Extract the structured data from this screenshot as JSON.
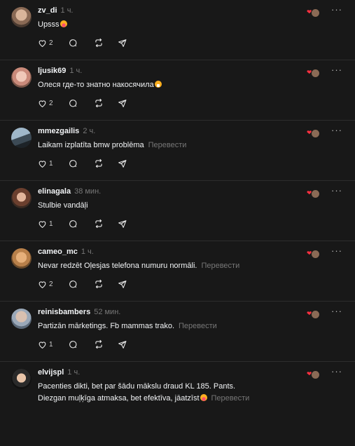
{
  "colors": {
    "background": "#181818",
    "divider": "#2d2d2d",
    "heart": "#ff3040",
    "muted": "#777777"
  },
  "icons": {
    "like": "heart-outline-icon",
    "reply": "comment-icon",
    "repost": "repost-icon",
    "share": "send-icon",
    "more": "more-icon",
    "reaction": "liked-heart-icon"
  },
  "translate_label": "Перевести",
  "posts": [
    {
      "username": "zv_di",
      "time": "1 ч.",
      "line1": "Upsss",
      "line2": "",
      "likes": "2",
      "translatable": false
    },
    {
      "username": "ljusik69",
      "time": "1 ч.",
      "line1": "Олеся где-то знатно накосячила",
      "line2": "",
      "likes": "2",
      "translatable": false
    },
    {
      "username": "mmezgailis",
      "time": "2 ч.",
      "line1": "Laikam izplatīta bmw problēma",
      "line2": "",
      "likes": "1",
      "translatable": true
    },
    {
      "username": "elinagala",
      "time": "38 мин.",
      "line1": "Stulbie vandāļi",
      "line2": "",
      "likes": "1",
      "translatable": false
    },
    {
      "username": "cameo_mc",
      "time": "1 ч.",
      "line1": "Nevar redzēt Oļesjas telefona numuru normāli.",
      "line2": "",
      "likes": "2",
      "translatable": true
    },
    {
      "username": "reinisbambers",
      "time": "52 мин.",
      "line1": "Partizān mārketings. Fb mammas trako.",
      "line2": "",
      "likes": "1",
      "translatable": true
    },
    {
      "username": "elvijspl",
      "time": "1 ч.",
      "line1": "Pacenties dikti, bet par šādu mākslu draud KL 185. Pants.",
      "line2": "Diezgan muļķīga atmaksa, bet efektīva, jāatzīst",
      "likes": "",
      "translatable": true
    }
  ]
}
